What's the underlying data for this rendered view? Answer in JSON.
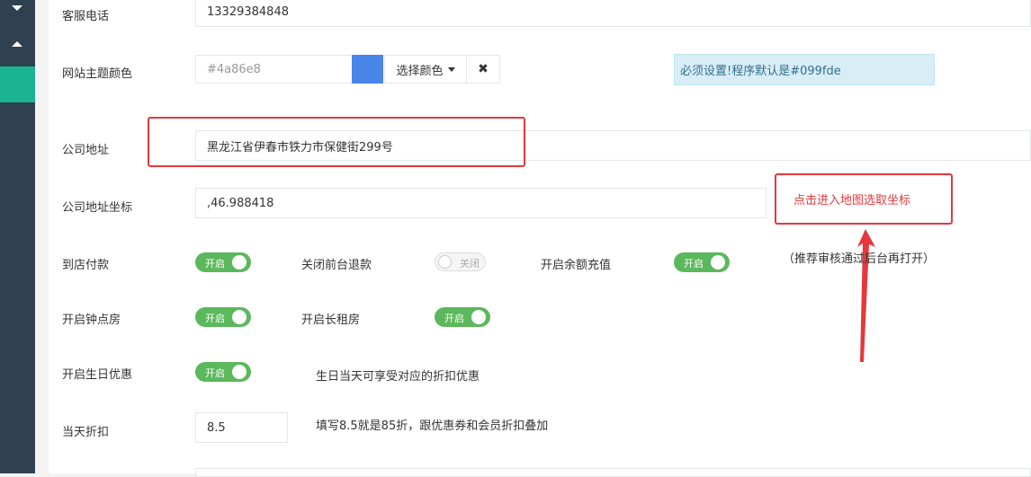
{
  "sidebar": {
    "arrow_down": "chevron-down-icon",
    "arrow_up": "chevron-up-icon"
  },
  "form": {
    "phone": {
      "label": "客服电话",
      "value": "13329384848"
    },
    "theme_color": {
      "label": "网站主题颜色",
      "placeholder": "#4a86e8",
      "swatch_color": "#4a86e8",
      "picker_label": "选择颜色",
      "clear_label": "✖",
      "alert": "必须设置!程序默认是#099fde"
    },
    "address": {
      "label": "公司地址",
      "value": "黑龙江省伊春市铁力市保健街299号"
    },
    "coords": {
      "label": "公司地址坐标",
      "value": ",46.988418",
      "map_link": "点击进入地图选取坐标"
    },
    "pay_at_store": {
      "label": "到店付款",
      "state": "开启"
    },
    "close_refund": {
      "label": "关闭前台退款",
      "state": "关闭"
    },
    "balance_recharge": {
      "label": "开启余额充值",
      "state": "开启",
      "hint": "（推荐审核通过后台再打开）"
    },
    "hourly_room": {
      "label": "开启钟点房",
      "state": "开启"
    },
    "long_rent": {
      "label": "开启长租房",
      "state": "开启"
    },
    "birthday": {
      "label": "开启生日优惠",
      "state": "开启",
      "hint": "生日当天可享受对应的折扣优惠"
    },
    "discount": {
      "label": "当天折扣",
      "value": "8.5",
      "hint": "填写8.5就是85折，跟优惠券和会员折扣叠加"
    }
  },
  "colors": {
    "accent": "#1ab394",
    "switch_on": "#5cb85c",
    "highlight": "#e4393c"
  }
}
